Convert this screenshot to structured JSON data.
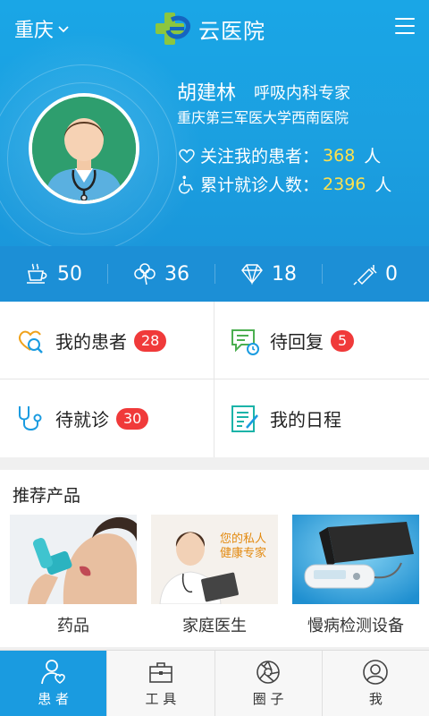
{
  "header": {
    "city": "重庆",
    "app_title": "云医院"
  },
  "doctor": {
    "name": "胡建林",
    "title": "呼吸内科专家",
    "hospital": "重庆第三军医大学西南医院",
    "followers_label": "关注我的患者：",
    "followers_count": "368",
    "followers_unit": "人",
    "visits_label": "累计就诊人数：",
    "visits_count": "2396",
    "visits_unit": "人"
  },
  "counters": [
    {
      "icon": "tea-cup-icon",
      "value": "50"
    },
    {
      "icon": "clover-icon",
      "value": "36"
    },
    {
      "icon": "diamond-icon",
      "value": "18"
    },
    {
      "icon": "syringe-icon",
      "value": "0"
    }
  ],
  "grid": {
    "my_patients": {
      "label": "我的患者",
      "badge": "28"
    },
    "pending_reply": {
      "label": "待回复",
      "badge": "5"
    },
    "pending_visit": {
      "label": "待就诊",
      "badge": "30"
    },
    "my_schedule": {
      "label": "我的日程"
    }
  },
  "products": {
    "title": "推荐产品",
    "items": [
      {
        "label": "药品"
      },
      {
        "label": "家庭医生",
        "overlay": "您的私人健康专家"
      },
      {
        "label": "慢病检测设备"
      }
    ]
  },
  "tabs": [
    {
      "label": "患 者",
      "icon": "patient-icon",
      "active": true
    },
    {
      "label": "工 具",
      "icon": "toolbox-icon",
      "active": false
    },
    {
      "label": "圈 子",
      "icon": "aperture-icon",
      "active": false
    },
    {
      "label": "我",
      "icon": "user-icon",
      "active": false
    }
  ],
  "colors": {
    "header_blue": "#1aa6e6",
    "counter_bar": "#1c8fd6",
    "highlight_yellow": "#ffe14d",
    "badge_red": "#f03a3a",
    "active_tab": "#1a9be0"
  }
}
